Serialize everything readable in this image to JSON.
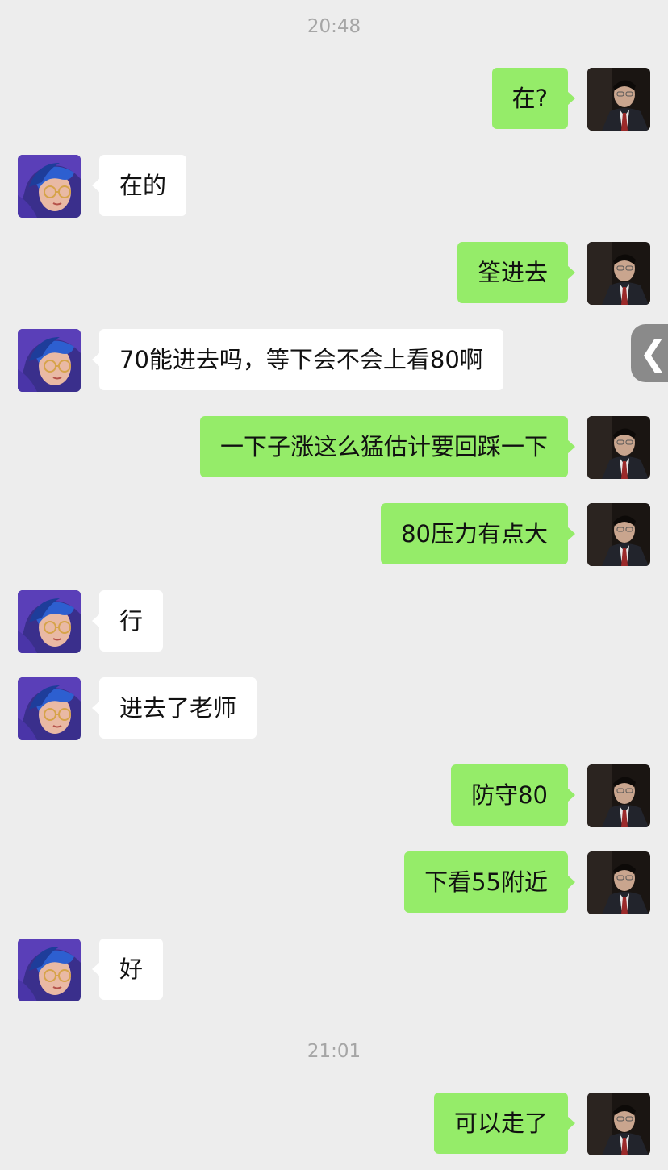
{
  "timestamps": [
    "20:48",
    "21:01"
  ],
  "messages": [
    {
      "side": "right",
      "text": "在?"
    },
    {
      "side": "left",
      "text": "在的"
    },
    {
      "side": "right",
      "text": "筌进去"
    },
    {
      "side": "left",
      "text": "70能进去吗，等下会不会上看80啊"
    },
    {
      "side": "right",
      "text": "一下子涨这么猛估计要回踩一下"
    },
    {
      "side": "right",
      "text": "80压力有点大"
    },
    {
      "side": "left",
      "text": "行"
    },
    {
      "side": "left",
      "text": "进去了老师"
    },
    {
      "side": "right",
      "text": "防守80"
    },
    {
      "side": "right",
      "text": "下看55附近"
    },
    {
      "side": "left",
      "text": "好"
    },
    {
      "side": "right",
      "text": "可以走了"
    }
  ],
  "side_handle": {
    "icon": "chevron-left-icon",
    "glyph": "❮"
  },
  "colors": {
    "background": "#ededed",
    "sent_bubble": "#95ec69",
    "received_bubble": "#ffffff",
    "timestamp": "#a6a6a6"
  }
}
